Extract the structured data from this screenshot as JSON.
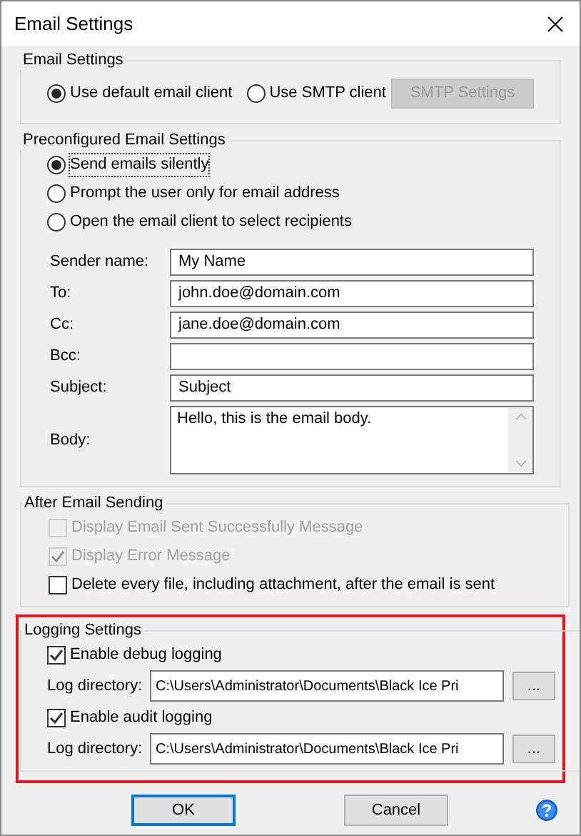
{
  "window": {
    "title": "Email Settings"
  },
  "email_settings": {
    "legend": "Email Settings",
    "options": [
      {
        "label": "Use default email client",
        "selected": true
      },
      {
        "label": "Use SMTP client",
        "selected": false
      }
    ],
    "smtp_button": {
      "label": "SMTP Settings",
      "disabled": true
    }
  },
  "preconfigured": {
    "legend": "Preconfigured Email Settings",
    "options": [
      {
        "label": "Send emails silently",
        "selected": true,
        "focused": true
      },
      {
        "label": "Prompt the user only for email address",
        "selected": false,
        "focused": false
      },
      {
        "label": "Open the email client to select recipients",
        "selected": false,
        "focused": false
      }
    ],
    "fields": [
      {
        "label": "Sender name:",
        "value": "My Name",
        "kind": "line"
      },
      {
        "label": "To:",
        "value": "john.doe@domain.com",
        "kind": "line"
      },
      {
        "label": "Cc:",
        "value": "jane.doe@domain.com",
        "kind": "line"
      },
      {
        "label": "Bcc:",
        "kind": "line"
      },
      {
        "label": "Subject:",
        "value": "Subject",
        "kind": "line"
      },
      {
        "label": "Body:",
        "value": "Hello, this is the email body.",
        "kind": "multiline"
      }
    ]
  },
  "after_sending": {
    "legend": "After Email Sending",
    "checkboxes": [
      {
        "label": "Display Email Sent Successfully Message",
        "checked": false,
        "disabled": true
      },
      {
        "label": "Display Error Message",
        "checked": true,
        "disabled": true
      },
      {
        "label": "Delete every file, including attachment, after the email is sent",
        "checked": false,
        "disabled": false
      }
    ]
  },
  "logging": {
    "legend": "Logging Settings",
    "highlighted": true,
    "entries": [
      {
        "label": "Enable debug logging",
        "checked": true,
        "directory_label": "Log directory:",
        "directory": "C:\\Users\\Administrator\\Documents\\Black Ice Pri",
        "browse": "..."
      },
      {
        "label": "Enable audit logging",
        "checked": true,
        "directory_label": "Log directory:",
        "directory": "C:\\Users\\Administrator\\Documents\\Black Ice Pri",
        "browse": "..."
      }
    ]
  },
  "buttons": [
    {
      "label": "OK",
      "default": true
    },
    {
      "label": "Cancel",
      "default": false
    }
  ]
}
